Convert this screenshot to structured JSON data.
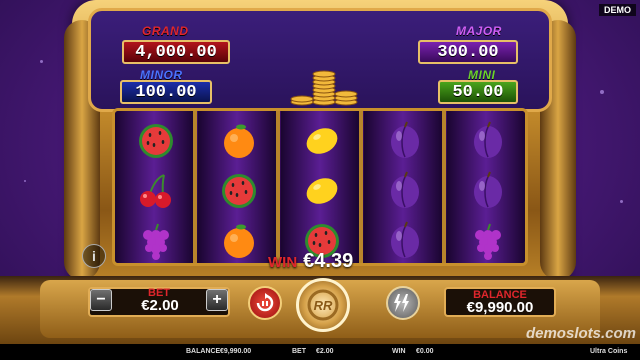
{
  "badge": {
    "demo": "DEMO"
  },
  "jackpots": {
    "grand": {
      "label": "GRAND",
      "value": "4,000.00"
    },
    "major": {
      "label": "MAJOR",
      "value": "300.00"
    },
    "minor": {
      "label": "MINOR",
      "value": "100.00"
    },
    "mini": {
      "label": "MINI",
      "value": "50.00"
    }
  },
  "reels": [
    [
      "watermelon-icon",
      "cherry-icon",
      "grapes-icon"
    ],
    [
      "orange-icon",
      "watermelon-icon",
      "orange-icon"
    ],
    [
      "lemon-icon",
      "lemon-icon",
      "watermelon-icon"
    ],
    [
      "plum-icon",
      "plum-icon",
      "plum-icon"
    ],
    [
      "plum-icon",
      "plum-icon",
      "grapes-icon"
    ]
  ],
  "win": {
    "label": "WIN",
    "value": "€4.39"
  },
  "info_button": {
    "label": "i"
  },
  "controls": {
    "bet_label": "BET",
    "bet_value": "€2.00",
    "minus": "−",
    "plus": "+",
    "balance_label": "BALANCE",
    "balance_value": "€9,990.00"
  },
  "status_bar": {
    "balance_label": "BALANCE",
    "balance_value": "€9,990.00",
    "bet_label": "BET",
    "bet_value": "€2.00",
    "win_label": "WIN",
    "win_value": "€0.00",
    "game_name": "Ultra Coins"
  },
  "watermark": "demoslots.com",
  "colors": {
    "grand": "#b2141c",
    "major": "#7a22b0",
    "minor": "#1c2eaa",
    "mini": "#4aa41c",
    "win_label": "#e0262c",
    "gold": "#d9a544"
  }
}
